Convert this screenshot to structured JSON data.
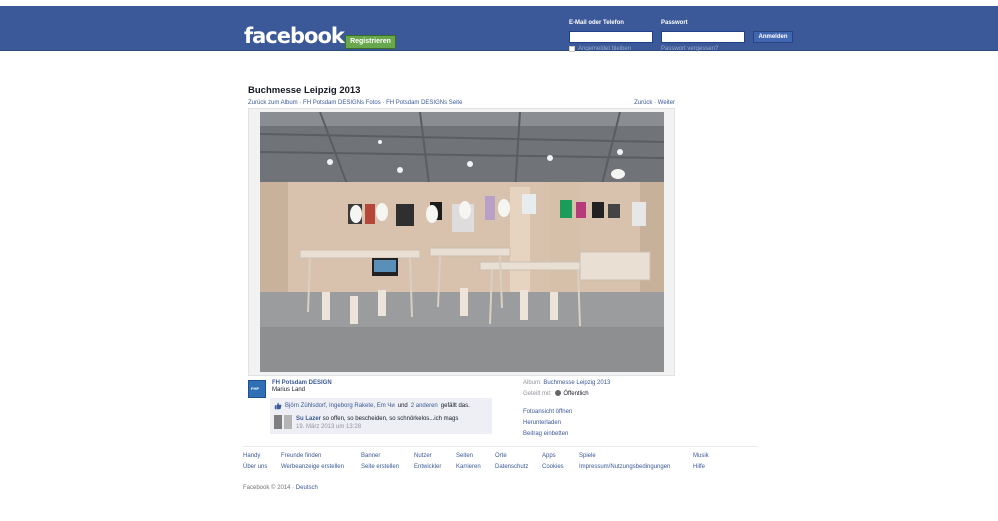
{
  "header": {
    "logo": "facebook",
    "register": "Registrieren",
    "email_label": "E-Mail oder Telefon",
    "password_label": "Passwort",
    "remember": "Angemeldet bleiben",
    "forgot": "Passwort vergessen?",
    "login": "Anmelden"
  },
  "photo_page": {
    "title": "Buchmesse Leipzig 2013",
    "breadcrumb": {
      "back": "Zurück zum Album",
      "sep": " · ",
      "photos": "FH Potsdam DESIGNs Fotos",
      "page": "FH Potsdam DESIGNs Seite"
    },
    "pager": {
      "prev": "Zurück",
      "sep": " · ",
      "next": "Weiter"
    }
  },
  "owner": {
    "avatar_text": "FHP",
    "name": "FH Potsdam DESIGN",
    "sub": "Marius Land"
  },
  "likes": {
    "names": "Björn Zühlsdorf, Ingeborg Rakete, Em Чи",
    "und": " und ",
    "others": "2 anderen",
    "suffix": " gefällt das."
  },
  "comment": {
    "author": "Su Lazer",
    "text": " so offen, so bescheiden, so schnörkelos...ich mags",
    "time": "19. März 2013 um 13:28"
  },
  "meta": {
    "album_label": "Album: ",
    "album": "Buchmesse Leipzig 2013",
    "shared_label": "Geteilt mit: ",
    "shared": "Öffentlich"
  },
  "actions": {
    "open": "Fotoansicht öffnen",
    "download": "Herunterladen",
    "embed": "Beitrag einbetten"
  },
  "footer": {
    "row1": [
      "Handy",
      "Freunde finden",
      "Banner",
      "Nutzer",
      "Seiten",
      "Orte",
      "Apps",
      "Spiele",
      "Musik"
    ],
    "row2": [
      "Über uns",
      "Werbeanzeige erstellen",
      "Seite erstellen",
      "Entwickler",
      "Karrieren",
      "Datenschutz",
      "Cookies",
      "Impressum/Nutzungsbedingungen",
      "Hilfe"
    ],
    "copyright": "Facebook © 2014 · ",
    "language": "Deutsch"
  },
  "colors": {
    "brand": "#3b5998",
    "register_green": "#69a74e"
  }
}
